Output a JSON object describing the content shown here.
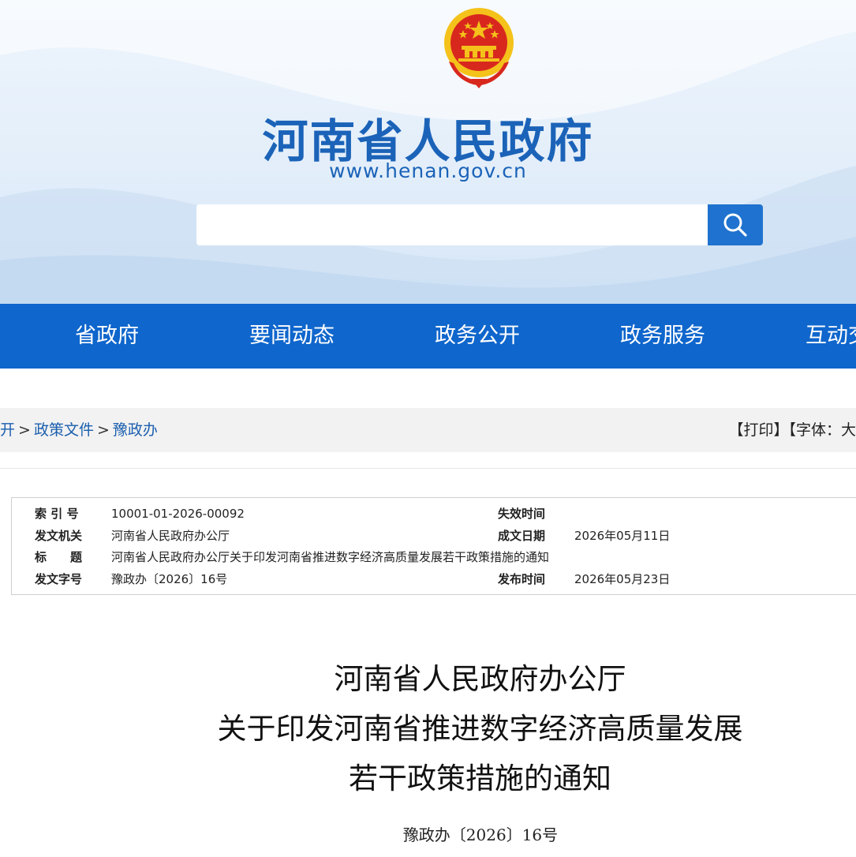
{
  "header": {
    "site_title": "河南省人民政府",
    "site_url": "www.henan.gov.cn",
    "search_placeholder": "",
    "colors": {
      "brand_blue": "#1b63b8",
      "nav_blue": "#0f66cc",
      "emblem_red": "#d8281e",
      "emblem_gold": "#f4c21a"
    }
  },
  "nav": {
    "items": [
      "省政府",
      "要闻动态",
      "政务公开",
      "政务服务",
      "互动交"
    ]
  },
  "breadcrumb": {
    "items": [
      "开",
      "政策文件",
      "豫政办"
    ],
    "separator": ">"
  },
  "tools": {
    "print": "【打印】",
    "font_size": "【字体：大"
  },
  "info": {
    "index_label": "索 引 号",
    "index_value": "10001-01-2026-00092",
    "issuer_label": "发文机关",
    "issuer_value": "河南省人民政府办公厅",
    "title_label": "标　　题",
    "title_value": "河南省人民政府办公厅关于印发河南省推进数字经济高质量发展若干政策措施的通知",
    "doc_no_label": "发文字号",
    "doc_no_value": "豫政办〔2026〕16号",
    "expiry_label": "失效时间",
    "expiry_value": "",
    "written_label": "成文日期",
    "written_value": "2026年05月11日",
    "published_label": "发布时间",
    "published_value": "2026年05月23日"
  },
  "document": {
    "title_lines": [
      "河南省人民政府办公厅",
      "关于印发河南省推进数字经济高质量发展",
      "若干政策措施的通知"
    ],
    "number": "豫政办〔2026〕16号"
  }
}
